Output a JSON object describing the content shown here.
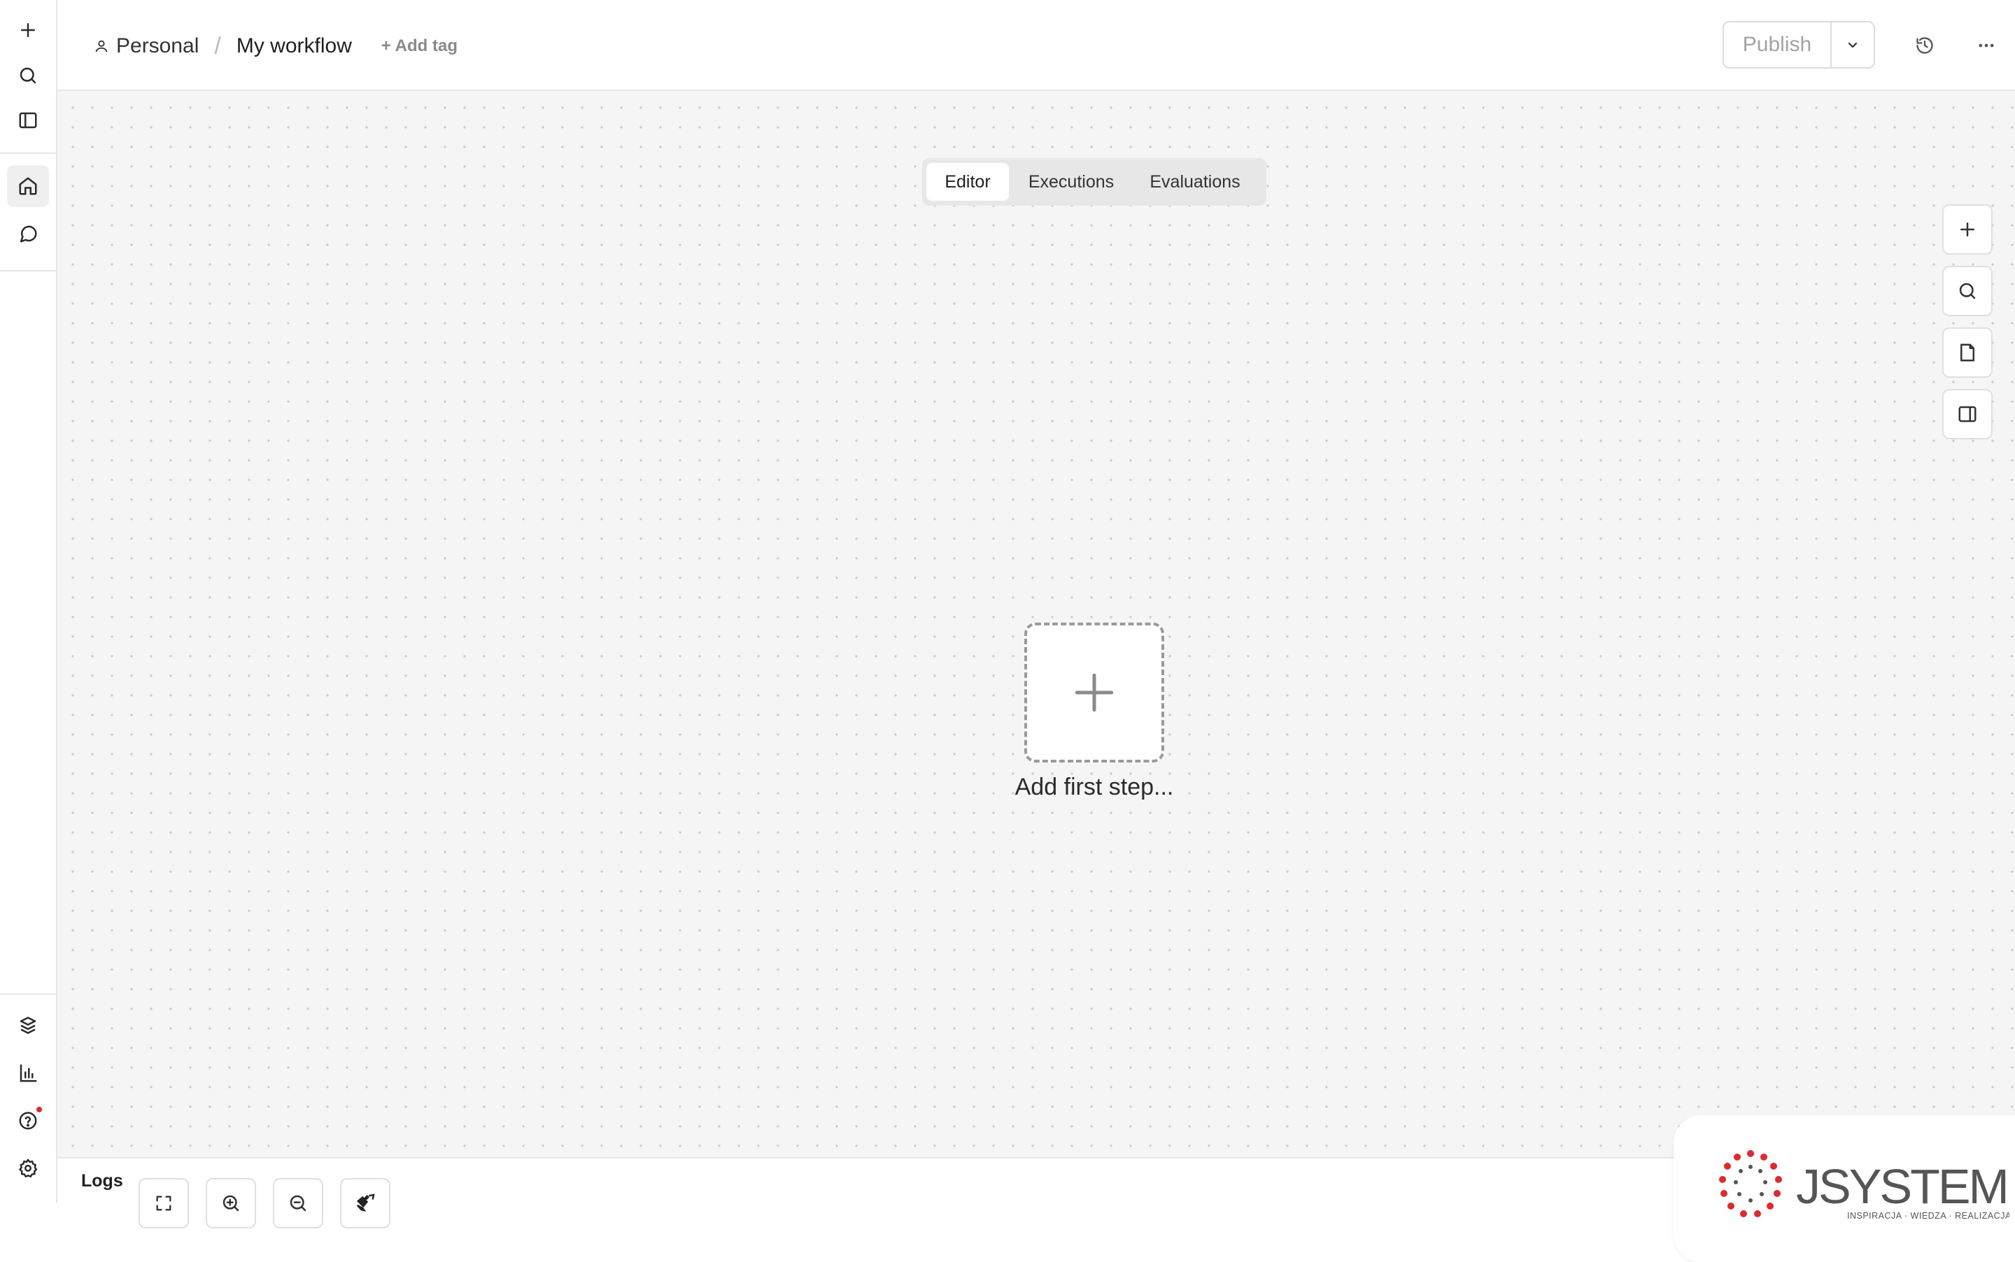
{
  "breadcrumb": {
    "project": "Personal",
    "separator": "/",
    "workflow_title": "My workflow",
    "add_tag": "+ Add tag"
  },
  "header": {
    "publish_label": "Publish"
  },
  "tabs": [
    {
      "label": "Editor",
      "active": true
    },
    {
      "label": "Executions",
      "active": false
    },
    {
      "label": "Evaluations",
      "active": false
    }
  ],
  "canvas": {
    "add_first_step": "Add first step..."
  },
  "sidebar": {
    "top_icons": [
      "plus-icon",
      "search-icon",
      "panel-left-icon"
    ],
    "nav_icons": [
      "home-icon",
      "chat-icon"
    ],
    "bottom_icons": [
      "templates-icon",
      "insights-icon",
      "help-icon",
      "settings-icon"
    ],
    "help_has_notification": true
  },
  "logo": {
    "brand": "JSYSTEMS",
    "tagline": "INSPIRACJA · WIEDZA · REALIZACJA"
  },
  "logs": {
    "label": "Logs"
  },
  "colors": {
    "canvas_bg": "#f5f5f5",
    "logo_red": "#e0282e",
    "logo_gray": "#555555"
  }
}
